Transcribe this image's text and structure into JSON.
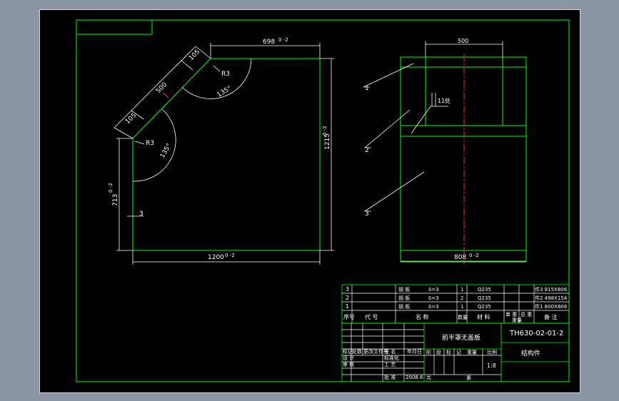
{
  "left_view": {
    "dims": {
      "top_width": "698",
      "top_width_tol": "0 -2",
      "segment_short_1": "105",
      "segment_long": "500",
      "segment_short_2": "105",
      "radius_upper": "R3",
      "radius_lower": "R3",
      "angle_upper": "135°",
      "angle_lower": "135°",
      "right_height": "1215",
      "right_height_tol": "0 -2",
      "left_height": "713",
      "left_height_tol": "0 -2",
      "thickness": "3",
      "bottom_width": "1200",
      "bottom_width_tol": "0 -2"
    }
  },
  "right_view": {
    "dims": {
      "top_width": "500",
      "bottom_width": "808",
      "bottom_width_tol": "0 -2",
      "weld_symbol": "11",
      "weld_note": "处"
    },
    "callouts": [
      "1",
      "2",
      "3"
    ]
  },
  "bom": {
    "rows": [
      {
        "no": "3",
        "name": "钢 板",
        "spec": "δ=3",
        "qty": "1",
        "material": "Q235",
        "note": "件3 815X806"
      },
      {
        "no": "2",
        "name": "钢 板",
        "spec": "δ=3",
        "qty": "2",
        "material": "Q235",
        "note": "件2 498X154"
      },
      {
        "no": "1",
        "name": "钢 板",
        "spec": "δ=3",
        "qty": "1",
        "material": "Q235",
        "note": "件1 800X806"
      }
    ],
    "header": {
      "no": "序号",
      "code": "代 号",
      "name": "名 称",
      "qty": "数量",
      "material": "材 料",
      "unit_weight": "单 重",
      "total_weight": "总 重",
      "weight": "重量",
      "note": "备 注"
    }
  },
  "title_block": {
    "drawing_title": "前半罩无盖板",
    "drawing_no": "TH630-02-01-2",
    "part_type": "结构件",
    "scale": "1:8",
    "labels": {
      "mark": "标记",
      "count": "处数",
      "zone": "分区",
      "change_doc": "更改文件号",
      "signature": "签 名",
      "date_col": "年月日",
      "design": "设 计",
      "standardize": "标准化",
      "review": "审 核",
      "process": "工 艺",
      "approve": "批 准",
      "stage_mark": "阶段标记",
      "weight": "重量",
      "scale": "比例",
      "sheets": "共",
      "sheet": "第",
      "stage_chars": [
        "阶",
        "段",
        "标",
        "记"
      ],
      "date": "2008.6"
    }
  }
}
